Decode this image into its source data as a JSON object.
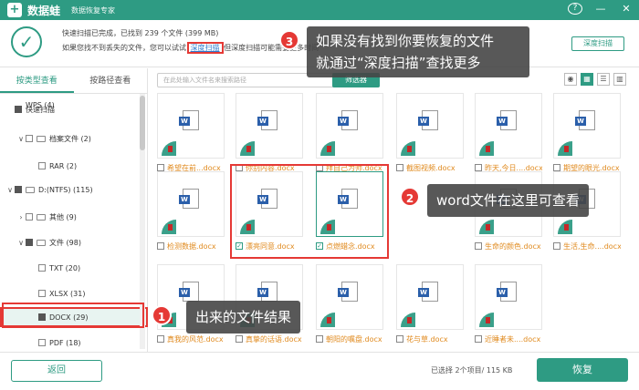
{
  "titlebar": {
    "logo": "+",
    "brand": "数据蛙",
    "subtitle": "数据恢复专家",
    "help": "?",
    "minimize": "—",
    "close": "✕"
  },
  "topinfo": {
    "line1": "快速扫描已完成，已找到 239 个文件 (399 MB)",
    "line2_before": "如果您找不到丢失的文件，您可以试试",
    "deep_link": "深度扫描",
    "line2_after": "但深度扫描可能需要更多时间",
    "deep_button": "深度扫描"
  },
  "sidebar": {
    "tabs": [
      "按类型查看",
      "按路径查看"
    ],
    "rows": [
      {
        "label": "快速扫描",
        "level": 0,
        "chev": "",
        "cb": "filled",
        "folder": false
      },
      {
        "label": "WPS (4)",
        "level": 1,
        "chev": "",
        "cb": "",
        "folder": false
      },
      {
        "label": "档案文件 (2)",
        "level": 1,
        "chev": "∨",
        "cb": "empty",
        "folder": true
      },
      {
        "label": "RAR (2)",
        "level": 2,
        "chev": "",
        "cb": "empty",
        "folder": false
      },
      {
        "label": "D:(NTFS) (115)",
        "level": 0,
        "chev": "∨",
        "cb": "filled",
        "folder": true
      },
      {
        "label": "其他 (9)",
        "level": 1,
        "chev": "›",
        "cb": "empty",
        "folder": true
      },
      {
        "label": "文件 (98)",
        "level": 1,
        "chev": "∨",
        "cb": "filled",
        "folder": true
      },
      {
        "label": "TXT (20)",
        "level": 2,
        "chev": "",
        "cb": "empty",
        "folder": false
      },
      {
        "label": "XLSX (31)",
        "level": 2,
        "chev": "",
        "cb": "empty",
        "folder": false
      },
      {
        "label": "DOCX (29)",
        "level": 2,
        "chev": "",
        "cb": "filled",
        "folder": false
      },
      {
        "label": "PDF (18)",
        "level": 2,
        "chev": "",
        "cb": "empty",
        "folder": false
      }
    ]
  },
  "search": {
    "placeholder": "在此处输入文件名来搜索路径",
    "button": "筛选器"
  },
  "view_icons": [
    "eye",
    "grid",
    "list",
    "detail"
  ],
  "files": [
    {
      "name": "希望在前...docx",
      "checked": false,
      "selected": false
    },
    {
      "name": "你别内容.docx",
      "checked": false,
      "selected": false
    },
    {
      "name": "拜自己为师.docx",
      "checked": false,
      "selected": false
    },
    {
      "name": "截图视频.docx",
      "checked": false,
      "selected": false
    },
    {
      "name": "昨天,今日....docx",
      "checked": false,
      "selected": false
    },
    {
      "name": "期望的眼光.docx",
      "checked": false,
      "selected": false
    },
    {
      "name": "检测数据.docx",
      "checked": false,
      "selected": false
    },
    {
      "name": "漂亮同意.docx",
      "checked": true,
      "selected": false
    },
    {
      "name": "点燃蜡念.docx",
      "checked": true,
      "selected": true
    },
    {
      "name": "",
      "checked": false,
      "selected": false
    },
    {
      "name": "生命的颜色.docx",
      "checked": false,
      "selected": false
    },
    {
      "name": "生活,生命....docx",
      "checked": false,
      "selected": false
    },
    {
      "name": "真我的风范.docx",
      "checked": false,
      "selected": false
    },
    {
      "name": "真挚的话语.docx",
      "checked": false,
      "selected": false
    },
    {
      "name": "朝阳的嘱盘.docx",
      "checked": false,
      "selected": false
    },
    {
      "name": "花与草.docx",
      "checked": false,
      "selected": false
    },
    {
      "name": "近睡者未....docx",
      "checked": false,
      "selected": false
    }
  ],
  "callouts": {
    "c1": {
      "num": "1",
      "text": "出来的文件结果"
    },
    "c2": {
      "num": "2",
      "text": "word文件在这里可查看"
    },
    "c3": {
      "num": "3",
      "text_line1": "如果没有找到你要恢复的文件",
      "text_line2": "就通过“深度扫描”查找更多"
    }
  },
  "bottom": {
    "back": "返回",
    "selection": "已选择 2个项目/ 115 KB",
    "recover": "恢复"
  },
  "colors": {
    "brand": "#2e9b83",
    "highlight_red": "#e53935",
    "filename_orange": "#e08a1e"
  }
}
